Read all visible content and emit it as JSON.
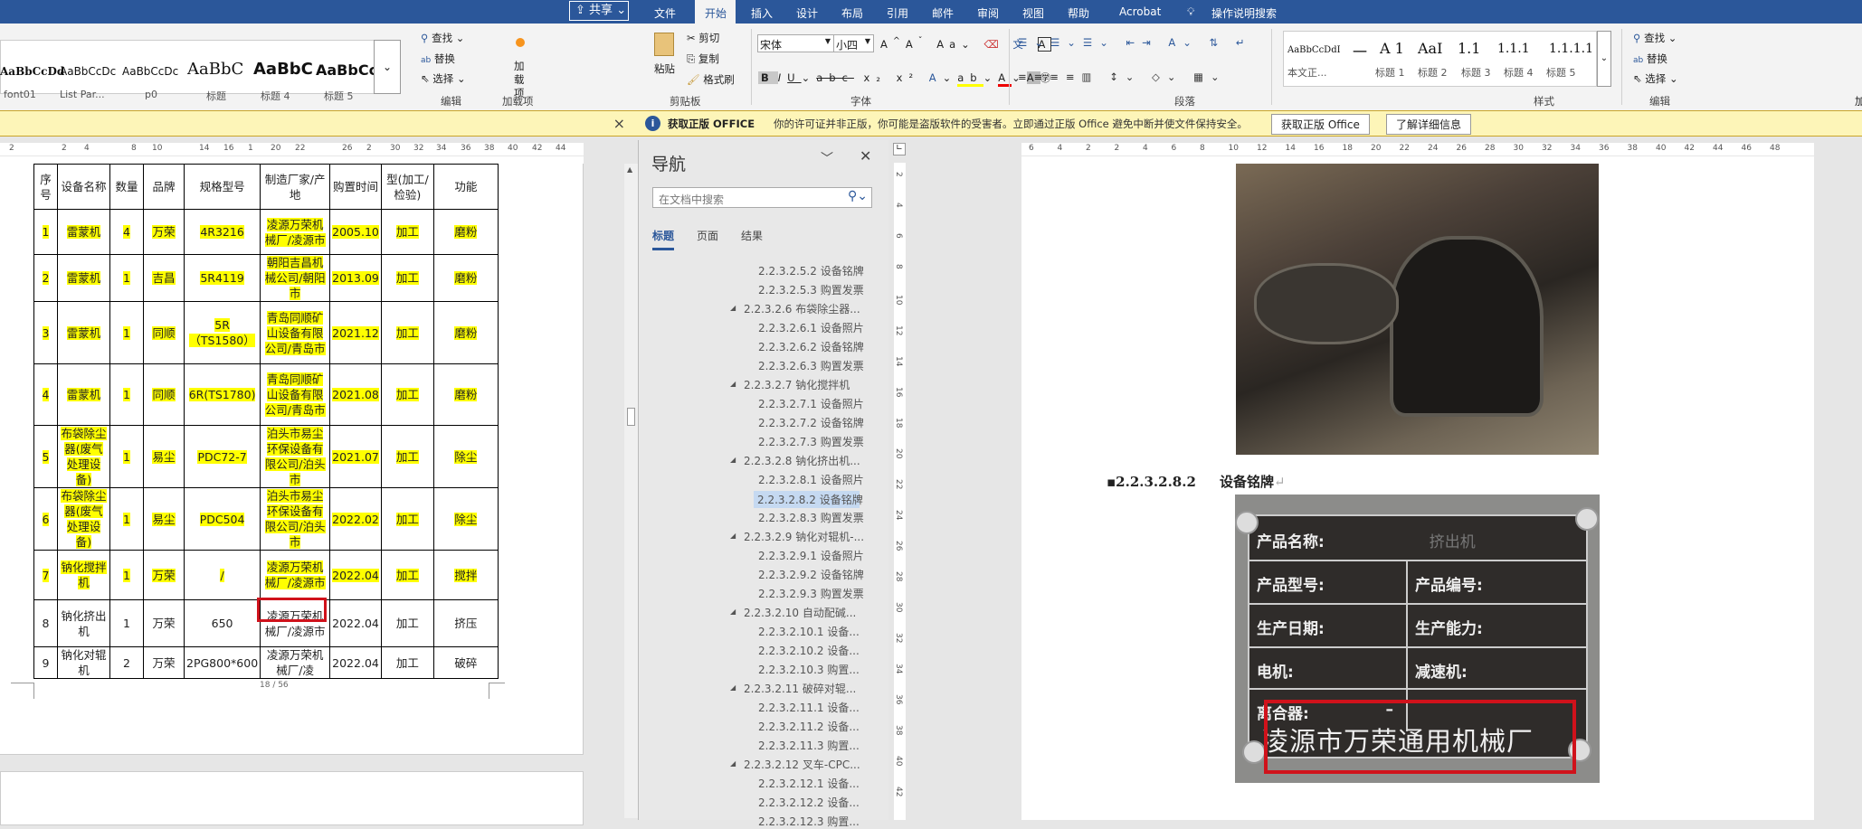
{
  "left_window": {
    "share_label": "共享",
    "styles": [
      {
        "preview": "AaBbCcDd",
        "label": "font01"
      },
      {
        "preview": "AaBbCcDc",
        "label": "List Par..."
      },
      {
        "preview": "AaBbCcDc",
        "label": "p0"
      },
      {
        "preview": "AaBbC",
        "label": "标题"
      },
      {
        "preview": "AaBbC",
        "label": "标题 4"
      },
      {
        "preview": "AaBbCc",
        "label": "标题 5"
      }
    ],
    "edit": {
      "find": "查找",
      "replace": "替换",
      "select": "选择",
      "group": "编辑"
    },
    "addins": {
      "label": "加载项",
      "group": "加载项"
    },
    "close_msg": "×",
    "ruler_ticks": [
      "2",
      "2",
      "4",
      "8",
      "10",
      "14",
      "16",
      "1",
      "20",
      "22",
      "26",
      "2",
      "30",
      "32",
      "34",
      "36",
      "38",
      "40",
      "42",
      "44"
    ],
    "table": {
      "headers": [
        "序号",
        "设备名称",
        "数量",
        "品牌",
        "规格型号",
        "制造厂家/产地",
        "购置时间",
        "型(加工/检验)",
        "功能"
      ],
      "rows": [
        {
          "cells": [
            "1",
            "雷蒙机",
            "4",
            "万荣",
            "4R3216",
            "凌源万荣机械厂/凌源市",
            "2005.10",
            "加工",
            "磨粉"
          ],
          "highlight": true
        },
        {
          "cells": [
            "2",
            "雷蒙机",
            "1",
            "吉昌",
            "5R4119",
            "朝阳吉昌机械公司/朝阳市",
            "2013.09",
            "加工",
            "磨粉"
          ],
          "highlight": true
        },
        {
          "cells": [
            "3",
            "雷蒙机",
            "1",
            "同顺",
            "5R（TS1580）",
            "青岛同顺矿山设备有限公司/青岛市",
            "2021.12",
            "加工",
            "磨粉"
          ],
          "highlight": true
        },
        {
          "cells": [
            "4",
            "雷蒙机",
            "1",
            "同顺",
            "6R(TS1780)",
            "青岛同顺矿山设备有限公司/青岛市",
            "2021.08",
            "加工",
            "磨粉"
          ],
          "highlight": true
        },
        {
          "cells": [
            "5",
            "布袋除尘器(废气处理设备)",
            "1",
            "易尘",
            "PDC72-7",
            "泊头市易尘环保设备有限公司/泊头市",
            "2021.07",
            "加工",
            "除尘"
          ],
          "highlight": true
        },
        {
          "cells": [
            "6",
            "布袋除尘器(废气处理设备)",
            "1",
            "易尘",
            "PDC504",
            "泊头市易尘环保设备有限公司/泊头市",
            "2022.02",
            "加工",
            "除尘"
          ],
          "highlight": true
        },
        {
          "cells": [
            "7",
            "钠化搅拌机",
            "1",
            "万荣",
            "/",
            "凌源万荣机械厂/凌源市",
            "2022.04",
            "加工",
            "搅拌"
          ],
          "highlight": true
        },
        {
          "cells": [
            "8",
            "钠化挤出机",
            "1",
            "万荣",
            "650",
            "凌源万荣机械厂/凌源市",
            "2022.04",
            "加工",
            "挤压"
          ],
          "highlight": false
        },
        {
          "cells": [
            "9",
            "钠化对辊机",
            "2",
            "万荣",
            "2PG800*600",
            "凌源万荣机械厂/凌",
            "2022.04",
            "加工",
            "破碎"
          ],
          "highlight": false
        }
      ]
    },
    "page_number": "18 / 56"
  },
  "tabs": [
    "文件",
    "开始",
    "插入",
    "设计",
    "布局",
    "引用",
    "邮件",
    "审阅",
    "视图",
    "帮助",
    "Acrobat"
  ],
  "tell_me": "操作说明搜索",
  "ribbon": {
    "clipboard": {
      "paste": "粘贴",
      "cut": "剪切",
      "copy": "复制",
      "format_painter": "格式刷",
      "group": "剪贴板"
    },
    "font": {
      "name": "宋体",
      "size": "小四",
      "group": "字体"
    },
    "paragraph": {
      "group": "段落"
    },
    "styles": {
      "group": "样式",
      "items": [
        {
          "preview": "AaBbCcDdI",
          "label": "本文正..."
        },
        {
          "preview": "一",
          "label": ""
        },
        {
          "preview": "A 1",
          "label": "标题 1"
        },
        {
          "preview": "AaI",
          "label": "标题 2"
        },
        {
          "preview": "1.1",
          "label": "标题 3"
        },
        {
          "preview": "1.1.1",
          "label": "标题 4"
        },
        {
          "preview": "1.1.1.1",
          "label": "标题 5"
        }
      ]
    },
    "editing": {
      "find": "查找",
      "replace": "替换",
      "select": "选择",
      "group": "编辑"
    },
    "addins_partial": "加"
  },
  "message_bar": {
    "title": "获取正版 OFFICE",
    "text": "你的许可证并非正版，你可能是盗版软件的受害者。立即通过正版 Office 避免中断并使文件保持安全。",
    "btn_get": "获取正版 Office",
    "btn_learn": "了解详细信息"
  },
  "nav": {
    "title": "导航",
    "search_placeholder": "在文档中搜索",
    "tabs": [
      "标题",
      "页面",
      "结果"
    ],
    "items": [
      {
        "level": 5,
        "text": "2.2.3.2.5.2 设备铭牌"
      },
      {
        "level": 5,
        "text": "2.2.3.2.5.3 购置发票"
      },
      {
        "level": 4,
        "text": "2.2.3.2.6 布袋除尘器..."
      },
      {
        "level": 5,
        "text": "2.2.3.2.6.1 设备照片"
      },
      {
        "level": 5,
        "text": "2.2.3.2.6.2 设备铭牌"
      },
      {
        "level": 5,
        "text": "2.2.3.2.6.3 购置发票"
      },
      {
        "level": 4,
        "text": "2.2.3.2.7 钠化搅拌机"
      },
      {
        "level": 5,
        "text": "2.2.3.2.7.1 设备照片"
      },
      {
        "level": 5,
        "text": "2.2.3.2.7.2 设备铭牌"
      },
      {
        "level": 5,
        "text": "2.2.3.2.7.3 购置发票"
      },
      {
        "level": 4,
        "text": "2.2.3.2.8 钠化挤出机..."
      },
      {
        "level": 5,
        "text": "2.2.3.2.8.1 设备照片"
      },
      {
        "level": 5,
        "text": "2.2.3.2.8.2 设备铭牌",
        "selected": true
      },
      {
        "level": 5,
        "text": "2.2.3.2.8.3 购置发票"
      },
      {
        "level": 4,
        "text": "2.2.3.2.9 钠化对辊机-..."
      },
      {
        "level": 5,
        "text": "2.2.3.2.9.1 设备照片"
      },
      {
        "level": 5,
        "text": "2.2.3.2.9.2 设备铭牌"
      },
      {
        "level": 5,
        "text": "2.2.3.2.9.3 购置发票"
      },
      {
        "level": 4,
        "text": "2.2.3.2.10 自动配碱..."
      },
      {
        "level": 5,
        "text": "2.2.3.2.10.1 设备..."
      },
      {
        "level": 5,
        "text": "2.2.3.2.10.2 设备..."
      },
      {
        "level": 5,
        "text": "2.2.3.2.10.3 购置..."
      },
      {
        "level": 4,
        "text": "2.2.3.2.11 破碎对辊..."
      },
      {
        "level": 5,
        "text": "2.2.3.2.11.1 设备..."
      },
      {
        "level": 5,
        "text": "2.2.3.2.11.2 设备..."
      },
      {
        "level": 5,
        "text": "2.2.3.2.11.3 购置..."
      },
      {
        "level": 4,
        "text": "2.2.3.2.12 叉车-CPC..."
      },
      {
        "level": 5,
        "text": "2.2.3.2.12.1 设备..."
      },
      {
        "level": 5,
        "text": "2.2.3.2.12.2 设备..."
      },
      {
        "level": 5,
        "text": "2.2.3.2.12.3 购置..."
      }
    ]
  },
  "right_ruler_ticks": [
    "6",
    "4",
    "2",
    "2",
    "4",
    "6",
    "8",
    "10",
    "12",
    "14",
    "16",
    "18",
    "20",
    "22",
    "24",
    "26",
    "28",
    "30",
    "32",
    "34",
    "36",
    "38",
    "40",
    "42",
    "44",
    "46",
    "48"
  ],
  "vruler_ticks": [
    "2",
    "4",
    "6",
    "8",
    "10",
    "12",
    "14",
    "16",
    "18",
    "20",
    "22",
    "24",
    "26",
    "28",
    "30",
    "32",
    "34",
    "36",
    "38",
    "40",
    "42"
  ],
  "document": {
    "heading_number": "2.2.3.2.8.2",
    "heading_text": "设备铭牌",
    "nameplate": {
      "name_label": "产品名称:",
      "name_value": "挤出机",
      "model": "产品型号:",
      "serial": "产品编号:",
      "date": "生产日期:",
      "capacity": "生产能力:",
      "motor": "电机:",
      "reducer": "减速机:",
      "clutch": "离合器:",
      "clutch_value": "–",
      "maker": "凌源市万荣通用机械厂"
    }
  },
  "colors": {
    "brand": "#2b579a",
    "highlight": "#ffff00",
    "annotation": "#d0121b"
  }
}
